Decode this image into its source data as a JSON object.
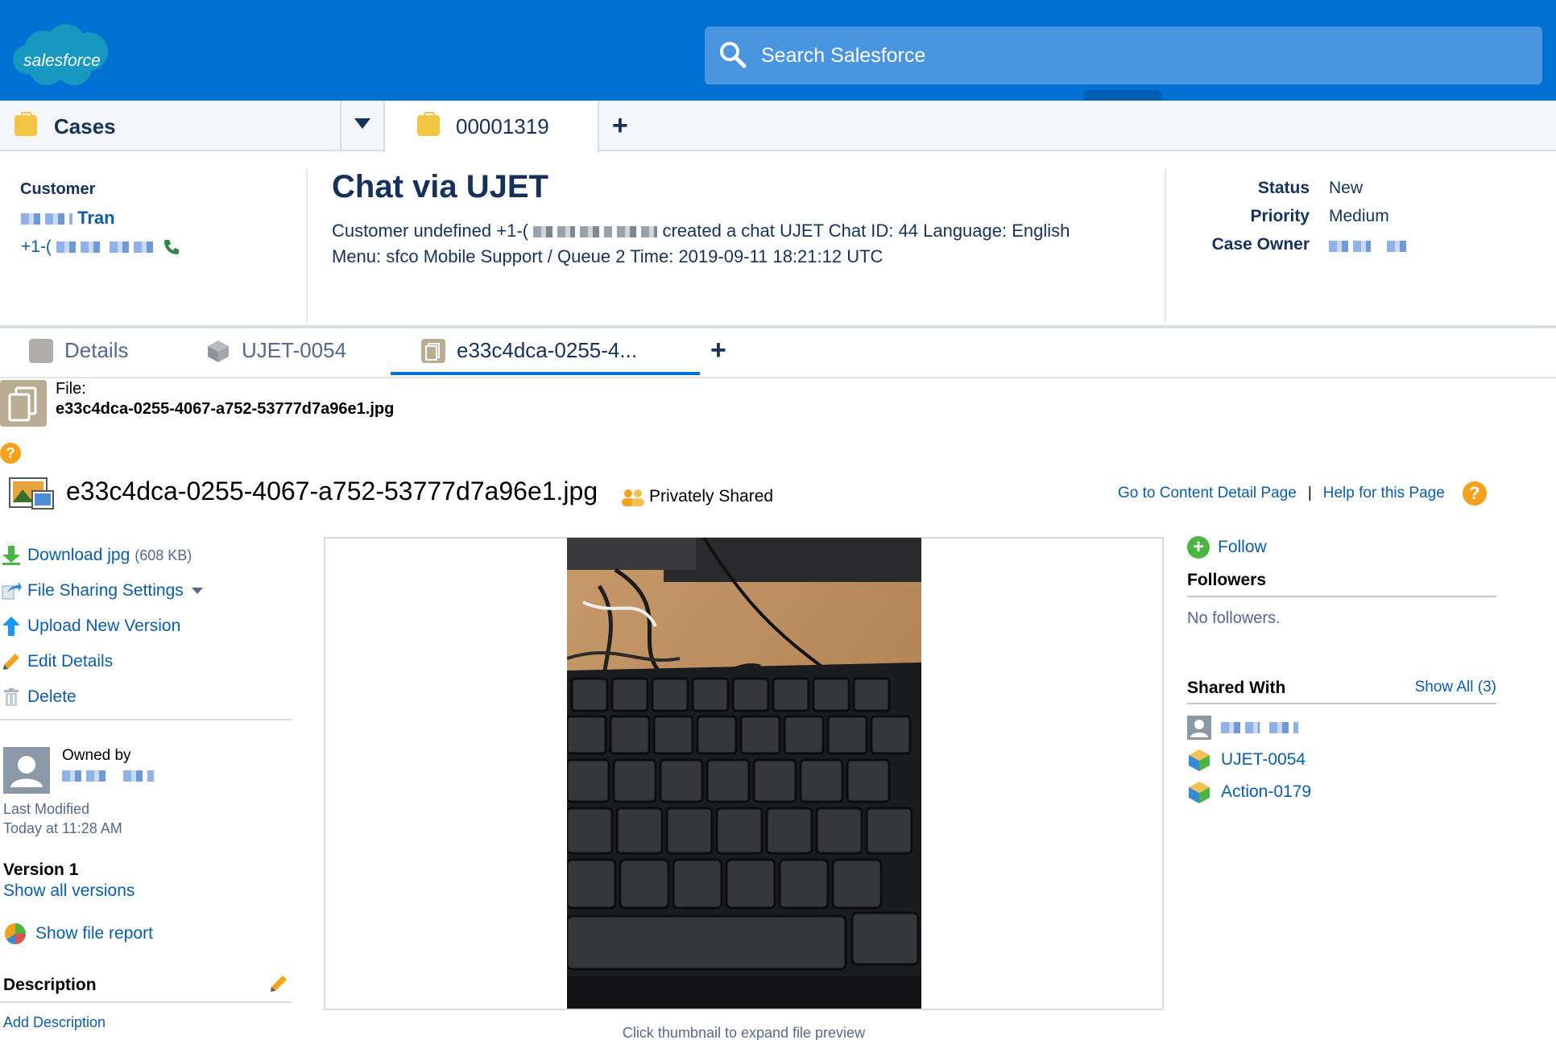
{
  "header": {
    "logo_text": "salesforce",
    "search_placeholder": "Search Salesforce"
  },
  "workspace_tabs": {
    "object_tab": "Cases",
    "record_tab": "00001319"
  },
  "record": {
    "customer_label": "Customer",
    "customer_name_suffix": "Tran",
    "customer_phone_prefix": "+1-(",
    "title": "Chat via UJET",
    "description_line1_a": "Customer undefined +1-(",
    "description_line1_b": "created a chat UJET Chat ID: 44 Language: English",
    "description_line2": "Menu: sfco Mobile Support / Queue 2 Time: 2019-09-11 18:21:12 UTC",
    "fields": [
      {
        "label": "Status",
        "value": "New"
      },
      {
        "label": "Priority",
        "value": "Medium"
      },
      {
        "label": "Case Owner",
        "value": ""
      }
    ]
  },
  "subtabs": [
    {
      "label": "Details",
      "active": false
    },
    {
      "label": "UJET-0054",
      "active": false
    },
    {
      "label": "e33c4dca-0255-4...",
      "active": true
    }
  ],
  "file": {
    "header_label": "File:",
    "header_name": "e33c4dca-0255-4067-a752-53777d7a96e1.jpg",
    "title": "e33c4dca-0255-4067-a752-53777d7a96e1.jpg",
    "sharing": "Privately Shared",
    "link_content_detail": "Go to Content Detail Page",
    "link_separator": "|",
    "link_help": "Help for this Page",
    "actions": {
      "download": "Download jpg",
      "download_size": "(608 KB)",
      "sharing_settings": "File Sharing Settings",
      "upload_version": "Upload New Version",
      "edit_details": "Edit Details",
      "delete": "Delete"
    },
    "owned_by_label": "Owned by",
    "last_modified_label": "Last Modified",
    "last_modified_value": "Today at 11:28 AM",
    "version_label": "Version 1",
    "show_versions": "Show all versions",
    "show_report": "Show file report",
    "description_label": "Description",
    "add_description": "Add Description",
    "preview_caption": "Click thumbnail to expand file preview"
  },
  "sidebar": {
    "follow": "Follow",
    "followers_heading": "Followers",
    "no_followers": "No followers.",
    "shared_with_heading": "Shared With",
    "show_all": "Show All (3)",
    "shared_items": [
      "UJET-0054",
      "Action-0179"
    ]
  },
  "colors": {
    "brand": "#0070d2",
    "link": "#0b5cab",
    "text": "#16325c",
    "case_icon": "#f4c542",
    "help": "#f2a31b"
  }
}
